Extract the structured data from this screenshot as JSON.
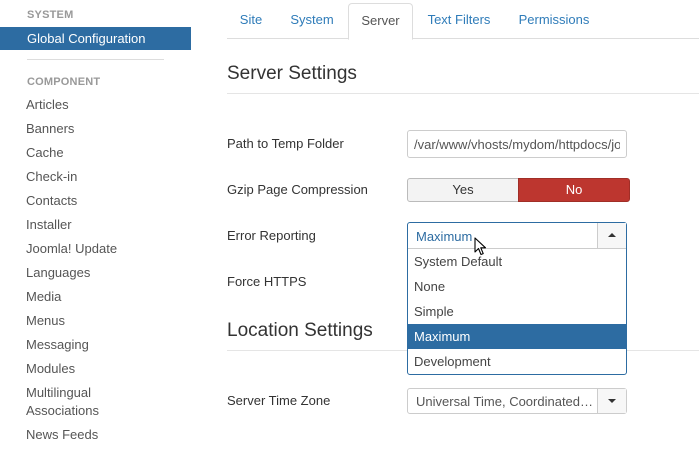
{
  "sidebar": {
    "system_heading": "SYSTEM",
    "active_item": "Global Configuration",
    "component_heading": "COMPONENT",
    "items": [
      {
        "label": "Articles"
      },
      {
        "label": "Banners"
      },
      {
        "label": "Cache"
      },
      {
        "label": "Check-in"
      },
      {
        "label": "Contacts"
      },
      {
        "label": "Installer"
      },
      {
        "label": "Joomla! Update"
      },
      {
        "label": "Languages"
      },
      {
        "label": "Media"
      },
      {
        "label": "Menus"
      },
      {
        "label": "Messaging"
      },
      {
        "label": "Modules"
      },
      {
        "label": "Multilingual Associations"
      },
      {
        "label": "News Feeds"
      }
    ]
  },
  "tabs": [
    {
      "label": "Site"
    },
    {
      "label": "System"
    },
    {
      "label": "Server"
    },
    {
      "label": "Text Filters"
    },
    {
      "label": "Permissions"
    }
  ],
  "active_tab": "Server",
  "server_settings": {
    "title": "Server Settings",
    "temp_path": {
      "label": "Path to Temp Folder",
      "value": "/var/www/vhosts/mydom/httpdocs/jo"
    },
    "gzip": {
      "label": "Gzip Page Compression",
      "yes": "Yes",
      "no": "No",
      "selected": "No"
    },
    "error_reporting": {
      "label": "Error Reporting",
      "current": "Maximum",
      "options": [
        "System Default",
        "None",
        "Simple",
        "Maximum",
        "Development"
      ],
      "selected": "Maximum"
    },
    "force_https": {
      "label": "Force HTTPS"
    }
  },
  "location_settings": {
    "title": "Location Settings",
    "time_zone": {
      "label": "Server Time Zone",
      "value": "Universal Time, Coordinated (UTC)"
    }
  },
  "colors": {
    "accent": "#2d6ca2",
    "link": "#2f7cb9",
    "danger": "#bd362f"
  }
}
